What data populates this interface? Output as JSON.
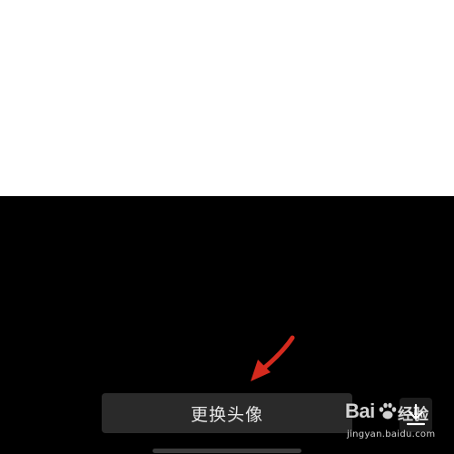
{
  "screen": {
    "background": "#000000",
    "image_background": "#ffffff"
  },
  "actions": {
    "change_avatar_label": "更换头像",
    "download_icon": "download-icon"
  },
  "annotation": {
    "arrow_icon": "red-arrow-icon",
    "arrow_color": "#d42a1e"
  },
  "watermark": {
    "logo_text": "Bai",
    "logo_suffix": "经验",
    "url": "jingyan.baidu.com"
  }
}
